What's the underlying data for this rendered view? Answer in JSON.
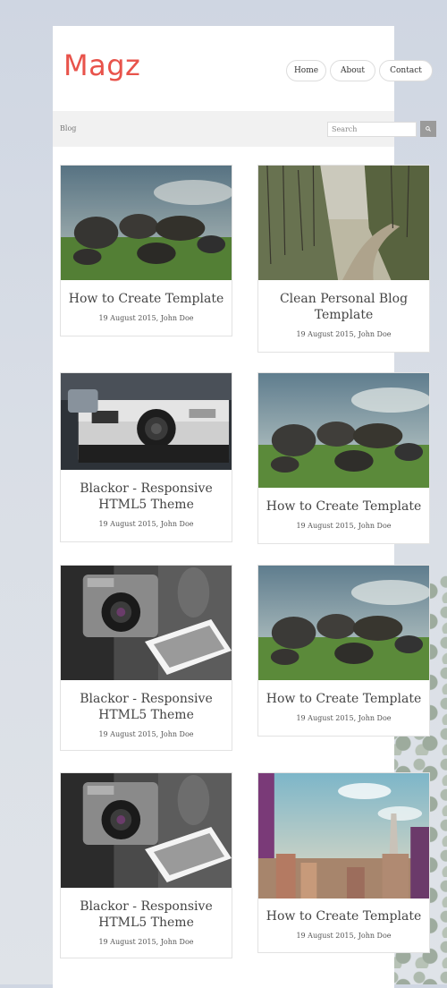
{
  "site": {
    "logo": "Magz"
  },
  "nav": {
    "items": [
      "Home",
      "About",
      "Contact"
    ]
  },
  "breadcrumb": "Blog",
  "search": {
    "placeholder": "Search"
  },
  "colors": {
    "accent": "#e8534b",
    "bar": "#f1f1f1"
  },
  "posts": [
    {
      "title": "How to Create Template",
      "meta": "19 August 2015, John Doe",
      "image": "rocks-field"
    },
    {
      "title": "Clean Personal Blog Template",
      "meta": "19 August 2015, John Doe",
      "image": "forest-road"
    },
    {
      "title": "Blackor - Responsive HTML5 Theme",
      "meta": "19 August 2015, John Doe",
      "image": "retro-camera"
    },
    {
      "title": "How to Create Template",
      "meta": "19 August 2015, John Doe",
      "image": "rocks-field"
    },
    {
      "title": "Blackor - Responsive HTML5 Theme",
      "meta": "19 August 2015, John Doe",
      "image": "camera-photo"
    },
    {
      "title": "How to Create Template",
      "meta": "19 August 2015, John Doe",
      "image": "rocks-field"
    },
    {
      "title": "Blackor - Responsive HTML5 Theme",
      "meta": "19 August 2015, John Doe",
      "image": "camera-photo"
    },
    {
      "title": "How to Create Template",
      "meta": "19 August 2015, John Doe",
      "image": "city-skyline"
    }
  ]
}
